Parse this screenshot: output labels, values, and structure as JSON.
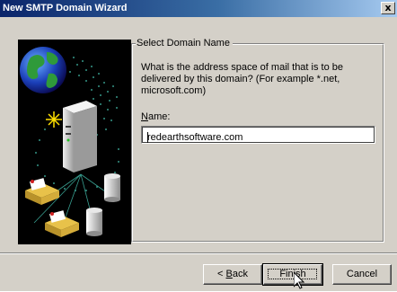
{
  "window": {
    "title": "New SMTP Domain Wizard",
    "close_label": "x"
  },
  "group": {
    "label": "Select Domain Name"
  },
  "question": "What is the address space of mail that is to be delivered by this domain? (For example *.net, microsoft.com)",
  "name_field": {
    "label": "Name:",
    "value": "redearthsoftware.com"
  },
  "buttons": {
    "back_prefix": "< ",
    "back_mnemonic": "B",
    "back_rest": "ack",
    "finish": "Finish",
    "cancel": "Cancel"
  },
  "colors": {
    "dialog_face": "#d4d0c8",
    "title_active_start": "#0a246a",
    "title_active_end": "#a6caf0"
  },
  "illustration": {
    "icons": [
      "globe-icon",
      "server-icon",
      "mail-tray-icon",
      "database-icon"
    ]
  }
}
